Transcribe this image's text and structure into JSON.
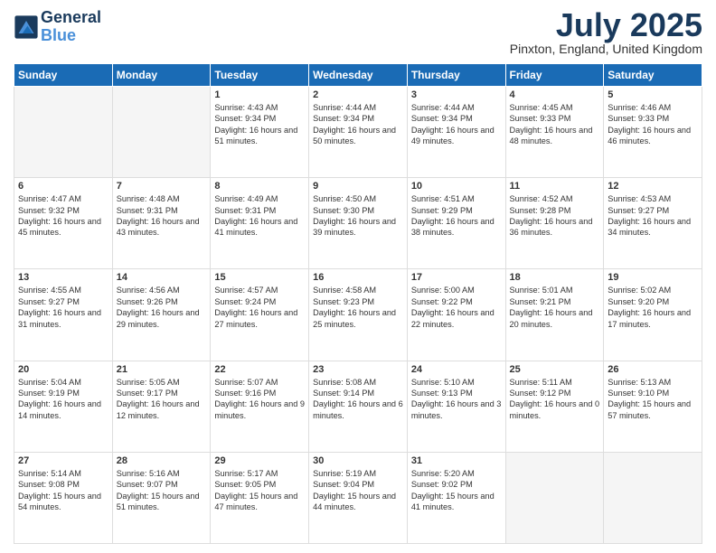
{
  "header": {
    "logo_line1": "General",
    "logo_line2": "Blue",
    "month": "July 2025",
    "location": "Pinxton, England, United Kingdom"
  },
  "days_of_week": [
    "Sunday",
    "Monday",
    "Tuesday",
    "Wednesday",
    "Thursday",
    "Friday",
    "Saturday"
  ],
  "weeks": [
    [
      {
        "day": null
      },
      {
        "day": null
      },
      {
        "day": "1",
        "sunrise": "Sunrise: 4:43 AM",
        "sunset": "Sunset: 9:34 PM",
        "daylight": "Daylight: 16 hours and 51 minutes."
      },
      {
        "day": "2",
        "sunrise": "Sunrise: 4:44 AM",
        "sunset": "Sunset: 9:34 PM",
        "daylight": "Daylight: 16 hours and 50 minutes."
      },
      {
        "day": "3",
        "sunrise": "Sunrise: 4:44 AM",
        "sunset": "Sunset: 9:34 PM",
        "daylight": "Daylight: 16 hours and 49 minutes."
      },
      {
        "day": "4",
        "sunrise": "Sunrise: 4:45 AM",
        "sunset": "Sunset: 9:33 PM",
        "daylight": "Daylight: 16 hours and 48 minutes."
      },
      {
        "day": "5",
        "sunrise": "Sunrise: 4:46 AM",
        "sunset": "Sunset: 9:33 PM",
        "daylight": "Daylight: 16 hours and 46 minutes."
      }
    ],
    [
      {
        "day": "6",
        "sunrise": "Sunrise: 4:47 AM",
        "sunset": "Sunset: 9:32 PM",
        "daylight": "Daylight: 16 hours and 45 minutes."
      },
      {
        "day": "7",
        "sunrise": "Sunrise: 4:48 AM",
        "sunset": "Sunset: 9:31 PM",
        "daylight": "Daylight: 16 hours and 43 minutes."
      },
      {
        "day": "8",
        "sunrise": "Sunrise: 4:49 AM",
        "sunset": "Sunset: 9:31 PM",
        "daylight": "Daylight: 16 hours and 41 minutes."
      },
      {
        "day": "9",
        "sunrise": "Sunrise: 4:50 AM",
        "sunset": "Sunset: 9:30 PM",
        "daylight": "Daylight: 16 hours and 39 minutes."
      },
      {
        "day": "10",
        "sunrise": "Sunrise: 4:51 AM",
        "sunset": "Sunset: 9:29 PM",
        "daylight": "Daylight: 16 hours and 38 minutes."
      },
      {
        "day": "11",
        "sunrise": "Sunrise: 4:52 AM",
        "sunset": "Sunset: 9:28 PM",
        "daylight": "Daylight: 16 hours and 36 minutes."
      },
      {
        "day": "12",
        "sunrise": "Sunrise: 4:53 AM",
        "sunset": "Sunset: 9:27 PM",
        "daylight": "Daylight: 16 hours and 34 minutes."
      }
    ],
    [
      {
        "day": "13",
        "sunrise": "Sunrise: 4:55 AM",
        "sunset": "Sunset: 9:27 PM",
        "daylight": "Daylight: 16 hours and 31 minutes."
      },
      {
        "day": "14",
        "sunrise": "Sunrise: 4:56 AM",
        "sunset": "Sunset: 9:26 PM",
        "daylight": "Daylight: 16 hours and 29 minutes."
      },
      {
        "day": "15",
        "sunrise": "Sunrise: 4:57 AM",
        "sunset": "Sunset: 9:24 PM",
        "daylight": "Daylight: 16 hours and 27 minutes."
      },
      {
        "day": "16",
        "sunrise": "Sunrise: 4:58 AM",
        "sunset": "Sunset: 9:23 PM",
        "daylight": "Daylight: 16 hours and 25 minutes."
      },
      {
        "day": "17",
        "sunrise": "Sunrise: 5:00 AM",
        "sunset": "Sunset: 9:22 PM",
        "daylight": "Daylight: 16 hours and 22 minutes."
      },
      {
        "day": "18",
        "sunrise": "Sunrise: 5:01 AM",
        "sunset": "Sunset: 9:21 PM",
        "daylight": "Daylight: 16 hours and 20 minutes."
      },
      {
        "day": "19",
        "sunrise": "Sunrise: 5:02 AM",
        "sunset": "Sunset: 9:20 PM",
        "daylight": "Daylight: 16 hours and 17 minutes."
      }
    ],
    [
      {
        "day": "20",
        "sunrise": "Sunrise: 5:04 AM",
        "sunset": "Sunset: 9:19 PM",
        "daylight": "Daylight: 16 hours and 14 minutes."
      },
      {
        "day": "21",
        "sunrise": "Sunrise: 5:05 AM",
        "sunset": "Sunset: 9:17 PM",
        "daylight": "Daylight: 16 hours and 12 minutes."
      },
      {
        "day": "22",
        "sunrise": "Sunrise: 5:07 AM",
        "sunset": "Sunset: 9:16 PM",
        "daylight": "Daylight: 16 hours and 9 minutes."
      },
      {
        "day": "23",
        "sunrise": "Sunrise: 5:08 AM",
        "sunset": "Sunset: 9:14 PM",
        "daylight": "Daylight: 16 hours and 6 minutes."
      },
      {
        "day": "24",
        "sunrise": "Sunrise: 5:10 AM",
        "sunset": "Sunset: 9:13 PM",
        "daylight": "Daylight: 16 hours and 3 minutes."
      },
      {
        "day": "25",
        "sunrise": "Sunrise: 5:11 AM",
        "sunset": "Sunset: 9:12 PM",
        "daylight": "Daylight: 16 hours and 0 minutes."
      },
      {
        "day": "26",
        "sunrise": "Sunrise: 5:13 AM",
        "sunset": "Sunset: 9:10 PM",
        "daylight": "Daylight: 15 hours and 57 minutes."
      }
    ],
    [
      {
        "day": "27",
        "sunrise": "Sunrise: 5:14 AM",
        "sunset": "Sunset: 9:08 PM",
        "daylight": "Daylight: 15 hours and 54 minutes."
      },
      {
        "day": "28",
        "sunrise": "Sunrise: 5:16 AM",
        "sunset": "Sunset: 9:07 PM",
        "daylight": "Daylight: 15 hours and 51 minutes."
      },
      {
        "day": "29",
        "sunrise": "Sunrise: 5:17 AM",
        "sunset": "Sunset: 9:05 PM",
        "daylight": "Daylight: 15 hours and 47 minutes."
      },
      {
        "day": "30",
        "sunrise": "Sunrise: 5:19 AM",
        "sunset": "Sunset: 9:04 PM",
        "daylight": "Daylight: 15 hours and 44 minutes."
      },
      {
        "day": "31",
        "sunrise": "Sunrise: 5:20 AM",
        "sunset": "Sunset: 9:02 PM",
        "daylight": "Daylight: 15 hours and 41 minutes."
      },
      {
        "day": null
      },
      {
        "day": null
      }
    ]
  ]
}
